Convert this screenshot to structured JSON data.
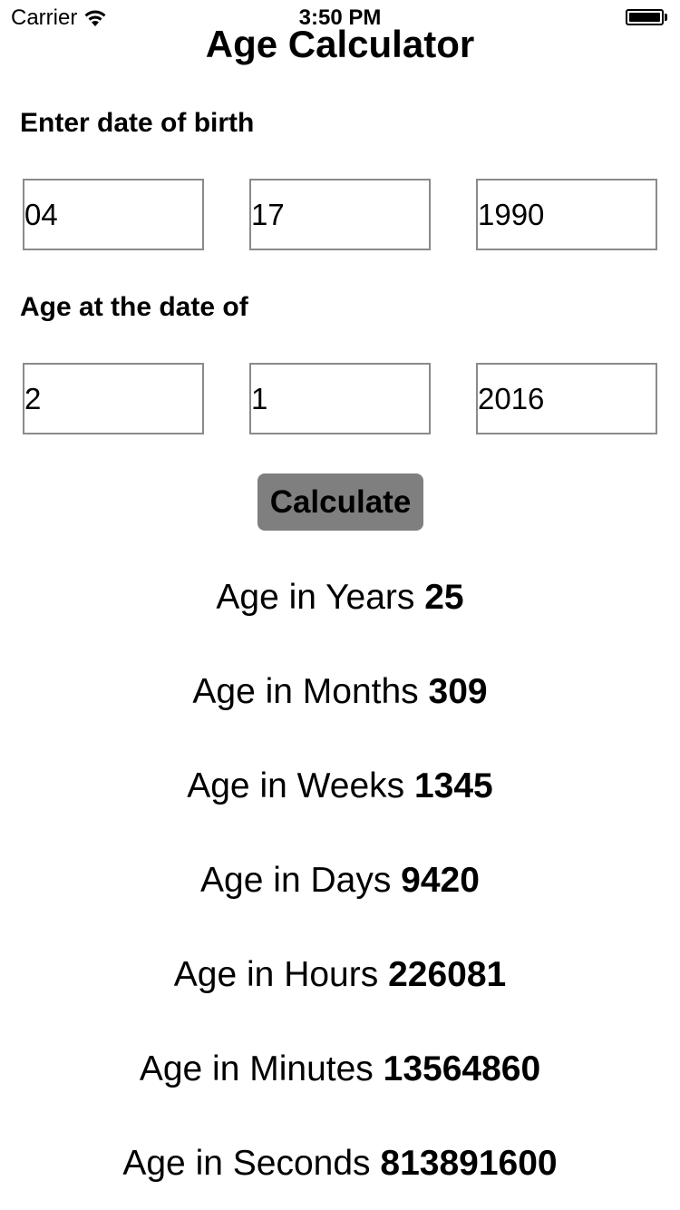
{
  "status_bar": {
    "carrier": "Carrier",
    "time": "3:50 PM",
    "wifi_icon": "wifi-icon",
    "battery_icon": "battery-full-icon"
  },
  "title": "Age Calculator",
  "birth": {
    "label": "Enter date of birth",
    "month": "04",
    "day": "17",
    "year": "1990"
  },
  "target": {
    "label": "Age at the date of",
    "month": "2",
    "day": "1",
    "year": "2016"
  },
  "calculate_button": {
    "label": "Calculate",
    "color": "#7f7f7f"
  },
  "results": [
    {
      "label": "Age in Years",
      "value": "25"
    },
    {
      "label": "Age in Months",
      "value": "309"
    },
    {
      "label": "Age in Weeks",
      "value": "1345"
    },
    {
      "label": "Age in Days",
      "value": "9420"
    },
    {
      "label": "Age in Hours",
      "value": "226081"
    },
    {
      "label": "Age in Minutes",
      "value": "13564860"
    },
    {
      "label": "Age in Seconds",
      "value": "813891600"
    }
  ]
}
